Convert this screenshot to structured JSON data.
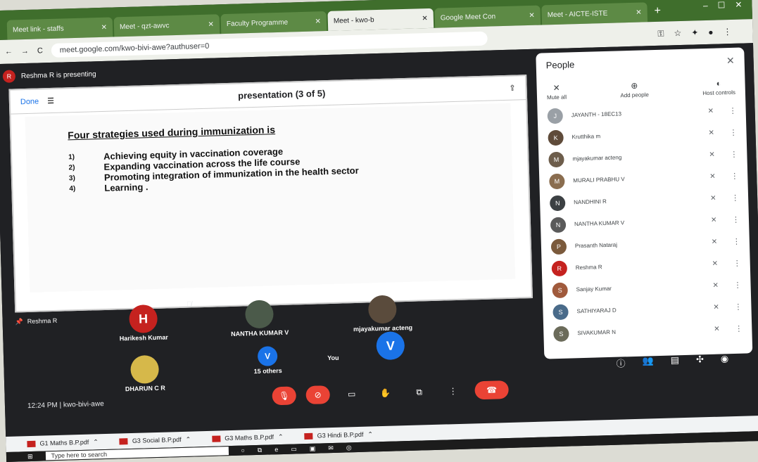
{
  "tabs": [
    {
      "label": "Meet link - staffs"
    },
    {
      "label": "Meet - qzt-awvc"
    },
    {
      "label": "Faculty Programme"
    },
    {
      "label": "Meet - kwo-b"
    },
    {
      "label": "Google Meet Con"
    },
    {
      "label": "Meet - AICTE-ISTE"
    }
  ],
  "url": "meet.google.com/kwo-bivi-awe?authuser=0",
  "presenter_label": "Reshma R is presenting",
  "presenter_initial": "R",
  "slide": {
    "toolbar_title": "presentation (3 of 5)",
    "done": "Done",
    "heading": "Four strategies used during immunization is",
    "points": [
      {
        "num": "1)",
        "text": "Achieving equity in vaccination coverage"
      },
      {
        "num": "2)",
        "text": "Expanding vaccination across the life course"
      },
      {
        "num": "3)",
        "text": "Promoting integration of immunization in the health sector"
      },
      {
        "num": "4)",
        "text": "Learning ."
      }
    ]
  },
  "self_label": "Reshma R",
  "tiles": {
    "harikesh": {
      "initial": "H",
      "name": "Harikesh Kumar"
    },
    "nantha": {
      "name": "NANTHA KUMAR V"
    },
    "mjaya": {
      "name": "mjayakumar acteng"
    },
    "dharun": {
      "name": "DHARUN C R"
    },
    "others": {
      "initial": "V",
      "name": "15 others"
    },
    "you": {
      "initial": "V",
      "name": "You"
    }
  },
  "meeting_info": "12:24 PM  |  kwo-bivi-awe",
  "people": {
    "title": "People",
    "mute_all": "Mute all",
    "add_people": "Add people",
    "host_controls": "Host controls",
    "list": [
      {
        "name": "JAYANTH - 18EC13",
        "initial": "J",
        "color": "#9aa0a6"
      },
      {
        "name": "Krutthika m",
        "initial": "K",
        "color": "#5f4b3a"
      },
      {
        "name": "mjayakumar acteng",
        "initial": "M",
        "color": "#6d5d4b"
      },
      {
        "name": "MURALI PRABHU V",
        "initial": "M",
        "color": "#8a6d4f"
      },
      {
        "name": "NANDHINI R",
        "initial": "N",
        "color": "#3c4043"
      },
      {
        "name": "NANTHA KUMAR V",
        "initial": "N",
        "color": "#5a5a5a"
      },
      {
        "name": "Prasanth Nataraj",
        "initial": "P",
        "color": "#7b5a3c"
      },
      {
        "name": "Reshma R",
        "initial": "R",
        "color": "#c5221f"
      },
      {
        "name": "Sanjay Kumar",
        "initial": "S",
        "color": "#a05a3c"
      },
      {
        "name": "SATHIYARAJ D",
        "initial": "S",
        "color": "#4a6b8a"
      },
      {
        "name": "SIVAKUMAR N",
        "initial": "S",
        "color": "#6b6b5a"
      }
    ]
  },
  "downloads": [
    {
      "name": "G1 Maths B.P.pdf"
    },
    {
      "name": "G3 Social B.P.pdf"
    },
    {
      "name": "G3 Maths B.P.pdf"
    },
    {
      "name": "G3 Hindi B.P.pdf"
    }
  ],
  "taskbar": {
    "search": "Type here to search"
  },
  "colors": {
    "end_call": "#ea4335",
    "meet_bg": "#202124",
    "avatar_h": "#c5221f",
    "avatar_v": "#1a73e8"
  }
}
